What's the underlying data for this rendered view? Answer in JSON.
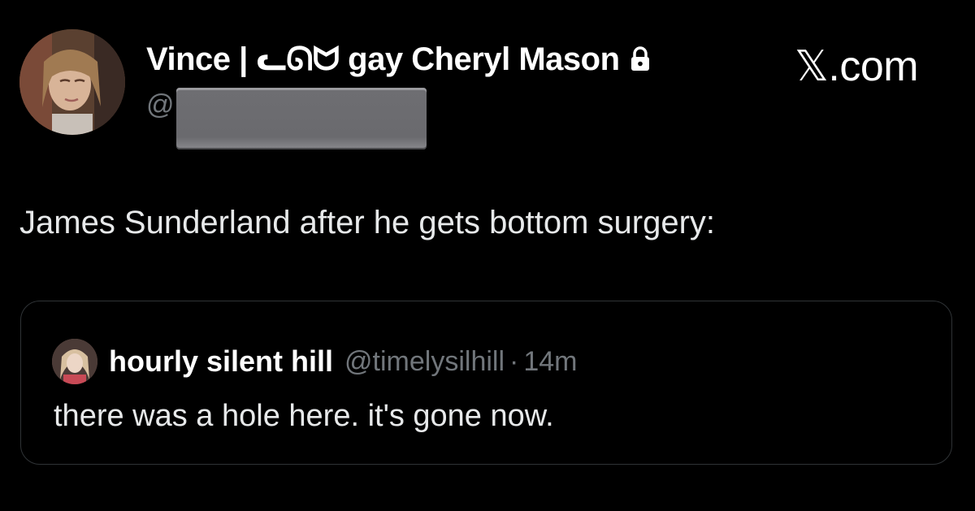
{
  "tweet": {
    "author": {
      "display_name": "Vince | ᓚᘏᗢ gay Cheryl Mason",
      "handle_prefix": "@",
      "protected_icon": "lock-icon",
      "avatar_icon": "profile-avatar"
    },
    "text": "James Sunderland after he gets bottom surgery:"
  },
  "brand": {
    "label": "𝕏.com"
  },
  "quoted_tweet": {
    "avatar_icon": "quoted-profile-avatar",
    "display_name": "hourly silent hill",
    "handle": "@timelysilhill",
    "separator": "·",
    "time": "14m",
    "text": "there was a hole here. it's gone now."
  },
  "colors": {
    "background": "#000000",
    "primary_text": "#e7e9ea",
    "secondary_text": "#71767b",
    "border": "#2f3336",
    "redaction": "#6e6e72"
  }
}
